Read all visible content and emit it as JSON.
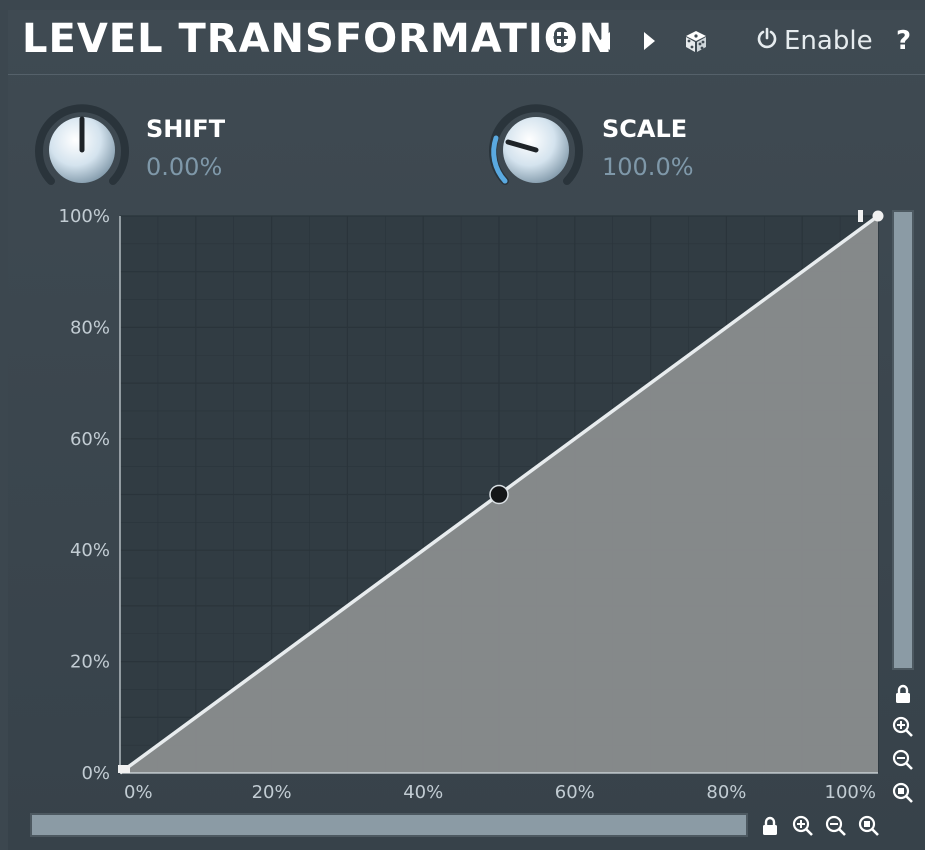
{
  "header": {
    "title": "LEVEL TRANSFORMATION",
    "menu_icon": "grid-icon",
    "prev_icon": "triangle-left-icon",
    "next_icon": "triangle-right-icon",
    "random_icon": "dice-icon",
    "enable_label": "Enable",
    "help_label": "?"
  },
  "knobs": [
    {
      "label": "SHIFT",
      "value": "0.00%",
      "position": 0.5
    },
    {
      "label": "SCALE",
      "value": "100.0%",
      "position": 0.25
    }
  ],
  "chart_data": {
    "type": "line",
    "x_ticks": [
      "0%",
      "20%",
      "40%",
      "60%",
      "80%",
      "100%"
    ],
    "y_ticks": [
      "0%",
      "20%",
      "40%",
      "60%",
      "80%",
      "100%"
    ],
    "xlim": [
      0,
      100
    ],
    "ylim": [
      0,
      100
    ],
    "grid": true,
    "series": [
      {
        "x": [
          0,
          100
        ],
        "y": [
          0,
          100
        ]
      }
    ],
    "control_point": {
      "x": 50,
      "y": 50
    },
    "colors": {
      "line": "#e8ecee",
      "fill": "#8a8d8e",
      "grid": "#2a343b"
    }
  },
  "zoom_controls": {
    "vertical": [
      "lock-icon",
      "zoom-in-icon",
      "zoom-out-icon",
      "zoom-reset-icon"
    ],
    "horizontal": [
      "lock-icon",
      "zoom-in-icon",
      "zoom-out-icon",
      "zoom-reset-icon"
    ]
  }
}
